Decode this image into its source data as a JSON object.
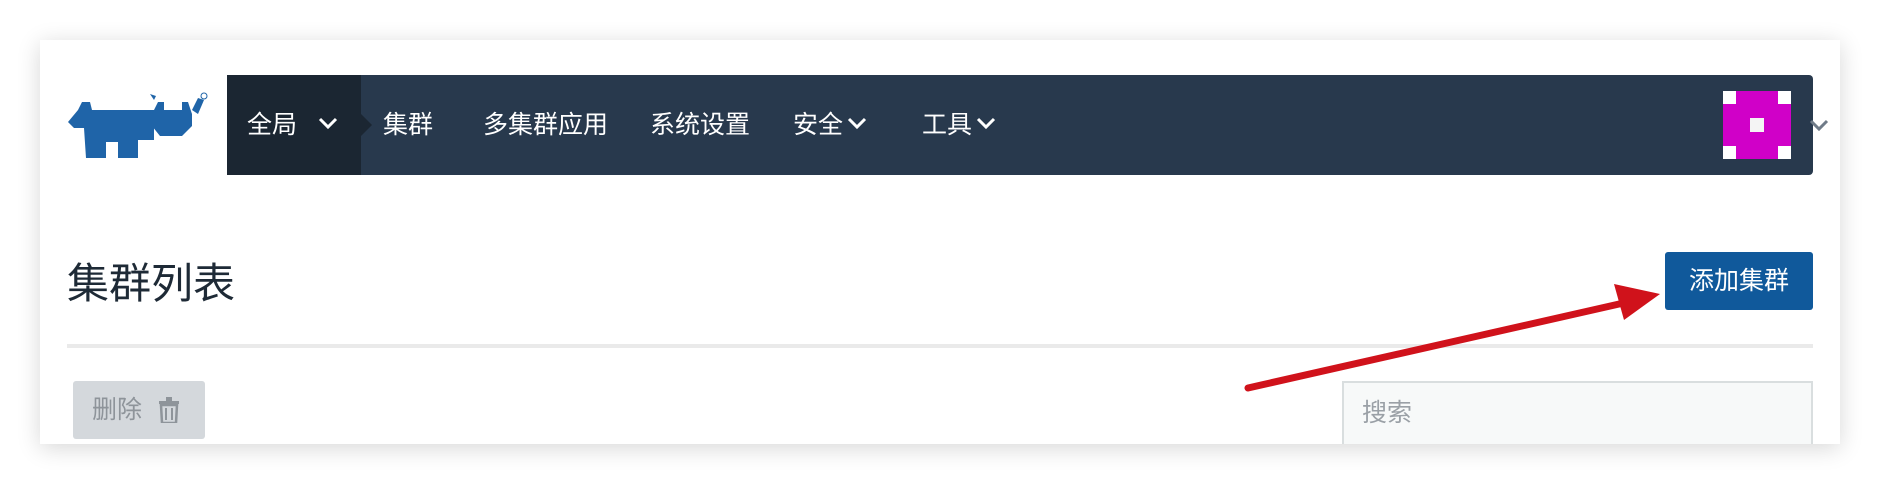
{
  "nav": {
    "global": "全局",
    "cluster": "集群",
    "multi_cluster_apps": "多集群应用",
    "system_settings": "系统设置",
    "security": "安全",
    "tools": "工具"
  },
  "page": {
    "title": "集群列表",
    "add_cluster_label": "添加集群",
    "delete_label": "删除",
    "search_placeholder": "搜索"
  },
  "colors": {
    "navbar": "#28394d",
    "nav_active": "#1b2632",
    "primary": "#10599b",
    "logo": "#1f64a8",
    "avatar": "#d000c8",
    "annotation_arrow": "#d0121b"
  },
  "icons": {
    "logo": "rancher-logo-icon",
    "dropdown": "chevron-down-icon",
    "delete": "trash-icon",
    "avatar": "identicon-avatar",
    "annotation": "red-arrow-annotation"
  }
}
